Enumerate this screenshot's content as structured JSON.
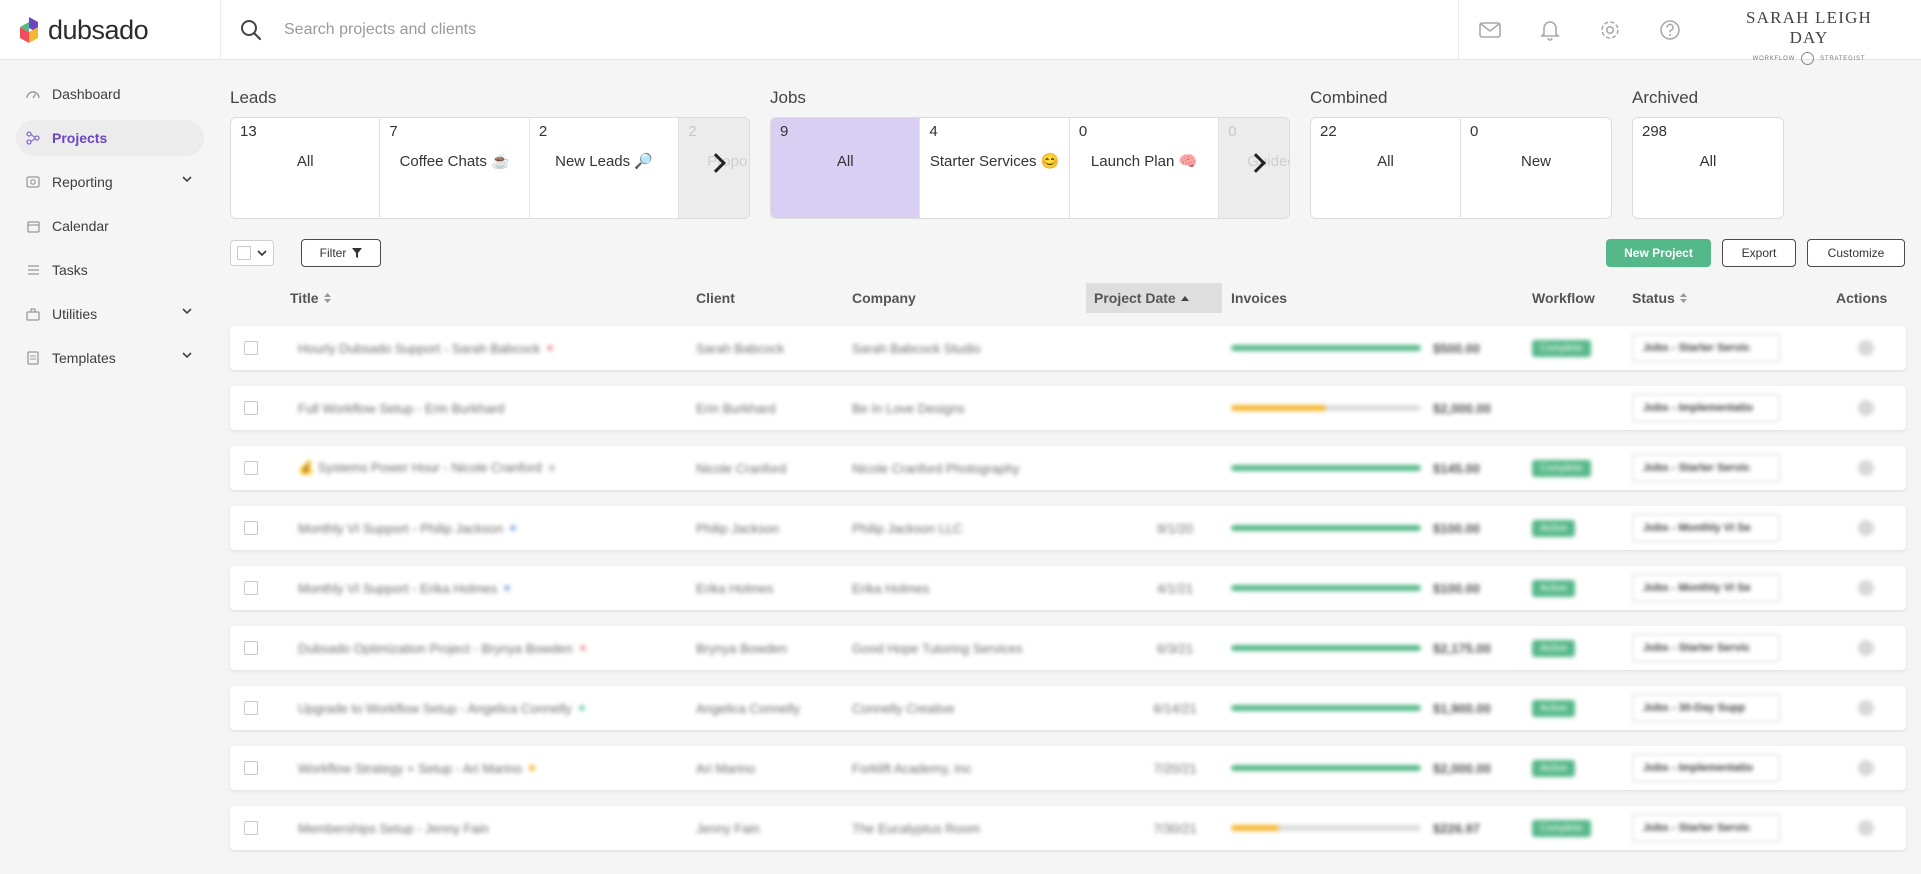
{
  "app": {
    "name": "dubsado"
  },
  "search": {
    "placeholder": "Search projects and clients"
  },
  "top_icons": [
    "mail-icon",
    "bell-icon",
    "gear-icon",
    "help-icon"
  ],
  "brand": {
    "name": "SARAH LEIGH DAY",
    "tag_left": "WORKFLOW",
    "tag_right": "STRATEGIST"
  },
  "sidebar": {
    "items": [
      {
        "label": "Dashboard",
        "icon": "dashboard-icon"
      },
      {
        "label": "Projects",
        "icon": "projects-icon",
        "active": true
      },
      {
        "label": "Reporting",
        "icon": "reporting-icon",
        "expandable": true
      },
      {
        "label": "Calendar",
        "icon": "calendar-icon"
      },
      {
        "label": "Tasks",
        "icon": "tasks-icon"
      },
      {
        "label": "Utilities",
        "icon": "utilities-icon",
        "expandable": true
      },
      {
        "label": "Templates",
        "icon": "templates-icon",
        "expandable": true
      }
    ]
  },
  "groups": {
    "leads": {
      "title": "Leads",
      "cards": [
        {
          "count": "13",
          "label": "All"
        },
        {
          "count": "7",
          "label": "Coffee Chats ☕"
        },
        {
          "count": "2",
          "label": "New Leads 🔎"
        },
        {
          "count": "2",
          "label": "Propo"
        }
      ]
    },
    "jobs": {
      "title": "Jobs",
      "cards": [
        {
          "count": "9",
          "label": "All",
          "selected": true
        },
        {
          "count": "4",
          "label": "Starter Services 😊"
        },
        {
          "count": "0",
          "label": "Launch Plan 🧠"
        },
        {
          "count": "0",
          "label": "Guidec"
        }
      ]
    },
    "combined": {
      "title": "Combined",
      "cards": [
        {
          "count": "22",
          "label": "All"
        },
        {
          "count": "0",
          "label": "New"
        }
      ]
    },
    "archived": {
      "title": "Archived",
      "cards": [
        {
          "count": "298",
          "label": "All"
        }
      ]
    }
  },
  "toolbar": {
    "filter_label": "Filter",
    "new_project_label": "New Project",
    "export_label": "Export",
    "customize_label": "Customize"
  },
  "table": {
    "columns": {
      "title": "Title",
      "client": "Client",
      "company": "Company",
      "project_date": "Project Date",
      "invoices": "Invoices",
      "workflow": "Workflow",
      "status": "Status",
      "actions": "Actions"
    },
    "rows": [
      {
        "title": "Hourly Dubsado Support - Sarah Babcock",
        "dot": "#f2a0a8",
        "client": "Sarah Babcock",
        "company": "Sarah Babcock Studio",
        "date": "",
        "paid": 1.0,
        "bar_color": "#55b889",
        "amount": "$500.00",
        "workflow": "Complete",
        "status": "Jobs - Starter Servic"
      },
      {
        "title": "Full Workflow Setup - Erin Burkhard",
        "dot": "",
        "client": "Erin Burkhard",
        "company": "Be In Love Designs",
        "date": "",
        "paid": 0.5,
        "bar_color": "#f5b731",
        "amount": "$2,000.00",
        "workflow": "",
        "status": "Jobs - Implementatio"
      },
      {
        "title": "💰 Systems Power Hour - Nicole Cranford",
        "dot": "#c0c0c0",
        "client": "Nicole Cranford",
        "company": "Nicole Cranford Photography",
        "date": "",
        "paid": 1.0,
        "bar_color": "#55b889",
        "amount": "$145.00",
        "workflow": "Complete",
        "status": "Jobs - Starter Servic"
      },
      {
        "title": "Monthly VI Support - Philip Jackson",
        "dot": "#8ab4e8",
        "client": "Philip Jackson",
        "company": "Philip Jackson LLC",
        "date": "9/1/20",
        "paid": 1.0,
        "bar_color": "#55b889",
        "amount": "$100.00",
        "workflow": "Active",
        "status": "Jobs - Monthly VI Se"
      },
      {
        "title": "Monthly VI Support - Erika Holmes",
        "dot": "#8ab4e8",
        "client": "Erika Holmes",
        "company": "Erika Holmes",
        "date": "4/1/21",
        "paid": 1.0,
        "bar_color": "#55b889",
        "amount": "$100.00",
        "workflow": "Active",
        "status": "Jobs - Monthly VI Se"
      },
      {
        "title": "Dubsado Optimization Project - Brynya Bowden",
        "dot": "#f2a0a8",
        "client": "Brynya Bowden",
        "company": "Good Hope Tutoring Services",
        "date": "6/3/21",
        "paid": 1.0,
        "bar_color": "#55b889",
        "amount": "$2,175.00",
        "workflow": "Active",
        "status": "Jobs - Starter Servic"
      },
      {
        "title": "Upgrade to Workflow Setup - Angelica Connelly",
        "dot": "#7fd1b5",
        "client": "Angelica Connelly",
        "company": "Connelly Creative",
        "date": "6/14/21",
        "paid": 1.0,
        "bar_color": "#55b889",
        "amount": "$1,900.00",
        "workflow": "Active",
        "status": "Jobs - 30-Day Supp"
      },
      {
        "title": "Workflow Strategy + Setup - Ari Marino",
        "dot": "#f5b731",
        "client": "Ari Marino",
        "company": "Forklift Academy, Inc",
        "date": "7/20/21",
        "paid": 1.0,
        "bar_color": "#55b889",
        "amount": "$2,000.00",
        "workflow": "Active",
        "status": "Jobs - Implementatio"
      },
      {
        "title": "Memberships Setup - Jenny Fain",
        "dot": "",
        "client": "Jenny Fain",
        "company": "The Eucalyptus Room",
        "date": "7/30/21",
        "paid": 0.25,
        "bar_color": "#f5b731",
        "amount": "$226.97",
        "workflow": "Complete",
        "status": "Jobs - Starter Servic"
      }
    ]
  }
}
